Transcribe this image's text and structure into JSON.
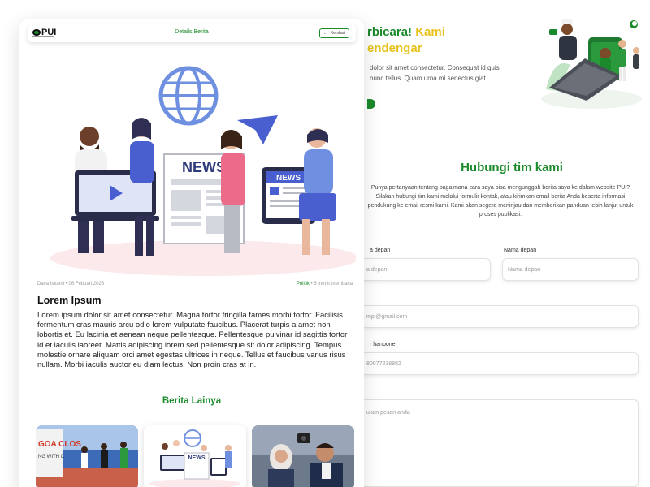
{
  "hero": {
    "title_part1": "rbicara!",
    "title_part2": "Kami",
    "title_line2": "endengar",
    "text": "dolor sit amet consectetur. Consequat id quis nunc tellus. Quam urna mi senectus giat."
  },
  "contact": {
    "title": "Hubungi tim kami",
    "text": "Punya pertanyaan tentang bagaimana cara saya bisa mengunggah berita saya ke dalam website PUI? Silakan hubungi tim kami melalui formulir kontak, atau kirimkan email berita Anda beserta informasi pendukung ke email resmi kami. Kami akan segera meninjau dan memberikan panduan lebih lanjut untuk proses publikasi.",
    "first_name_label": "a depan",
    "first_name_placeholder": "a depan",
    "last_name_label": "Nama depan",
    "last_name_placeholder": "Nama depan",
    "email_placeholder": "mpl@gmail.com",
    "phone_label": "r hanpone",
    "phone_placeholder": "80077238882",
    "message_placeholder": "ukan pesan anda"
  },
  "topbar": {
    "logo": "PUI",
    "title": "Details Berita",
    "back_label": "Kembali"
  },
  "article": {
    "illustration_label": "NEWS",
    "author_date": "Dava Iskami • 06 Febuari 2026",
    "category": "Politik",
    "read_time": "• 6 menit membaca",
    "title": "Lorem Ipsum",
    "body": "Lorem ipsum dolor sit amet consectetur. Magna tortor fringilla fames morbi tortor. Facilisis fermentum cras mauris arcu odio lorem vulputate faucibus. Placerat turpis a amet non lobortis et. Eu lacinia et aenean neque pellentesque. Pellentesque pulvinar id sagittis tortor id et iaculis laoreet. Mattis adipiscing lorem sed pellentesque sit dolor adipiscing. Tempus molestie ornare aliquam orci amet egestas ultrices in neque. Tellus et faucibus varius risus nullam. Morbi iaculis auctor eu diam lectus. Non proin cras at in."
  },
  "other_news": {
    "title": "Berita Lainya",
    "thumb1_text": "GOA CLOS",
    "thumb1_sub": "NG WITH C",
    "thumb2_label": "NEWS"
  },
  "colors": {
    "brand_green": "#1b8a2a",
    "accent_yellow": "#e8c21a",
    "illustration_blue": "#4a5fcf"
  }
}
